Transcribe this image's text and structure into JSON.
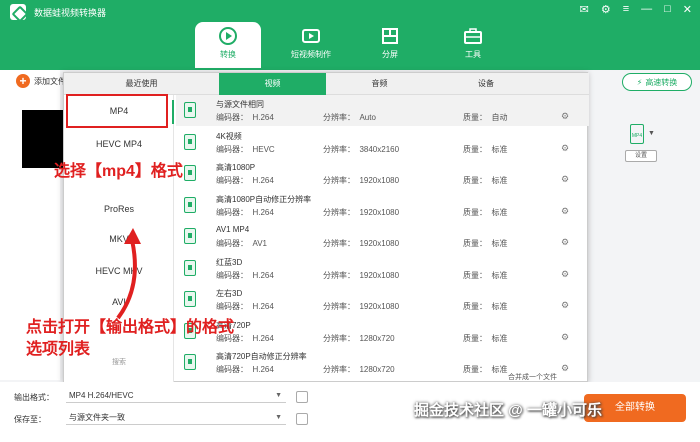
{
  "app": {
    "title": "数据蛙视频转换器",
    "win_controls": [
      "✉",
      "⚙",
      "≡",
      "—",
      "□",
      "✕"
    ]
  },
  "nav": [
    {
      "label": "转换",
      "icon": "convert-icon",
      "active": true
    },
    {
      "label": "短视频制作",
      "icon": "video-icon",
      "active": false
    },
    {
      "label": "分屏",
      "icon": "split-icon",
      "active": false
    },
    {
      "label": "工具",
      "icon": "toolbox-icon",
      "active": false
    }
  ],
  "left": {
    "add_label": "添加文件"
  },
  "right": {
    "speed_label": "高速转换",
    "settings_label": "设置",
    "format_badge": "MP4"
  },
  "popup": {
    "tabs": [
      "最近使用",
      "视频",
      "音频",
      "设备"
    ],
    "active_tab": 1,
    "categories": [
      "MP4",
      "HEVC MP4",
      "MOV",
      "ProRes",
      "MKV",
      "HEVC MKV",
      "AVI",
      "WebM",
      "5K/8K 视频"
    ],
    "selected_category": "MP4",
    "enc_label": "编码器：",
    "res_label": "分辨率：",
    "qual_label": "质量：",
    "formats": [
      {
        "name": "与源文件相同",
        "enc": "H.264",
        "res": "Auto",
        "qual": "自动"
      },
      {
        "name": "4K视频",
        "enc": "HEVC",
        "res": "3840x2160",
        "qual": "标准"
      },
      {
        "name": "高清1080P",
        "enc": "H.264",
        "res": "1920x1080",
        "qual": "标准"
      },
      {
        "name": "高清1080P自动修正分辨率",
        "enc": "H.264",
        "res": "1920x1080",
        "qual": "标准"
      },
      {
        "name": "AV1 MP4",
        "enc": "AV1",
        "res": "1920x1080",
        "qual": "标准"
      },
      {
        "name": "红蓝3D",
        "enc": "H.264",
        "res": "1920x1080",
        "qual": "标准"
      },
      {
        "name": "左右3D",
        "enc": "H.264",
        "res": "1920x1080",
        "qual": "标准"
      },
      {
        "name": "高清720P",
        "enc": "H.264",
        "res": "1280x720",
        "qual": "标准"
      },
      {
        "name": "高清720P自动修正分辨率",
        "enc": "H.264",
        "res": "1280x720",
        "qual": "标准"
      }
    ],
    "search_label": "搜索"
  },
  "bottom": {
    "output_label": "输出格式：",
    "output_value": "MP4 H.264/HEVC",
    "save_label": "保存至：",
    "save_value": "与源文件夹一致",
    "merge_label": "合并成一个文件",
    "convert_label": "全部转换"
  },
  "annotations": {
    "select_mp4": "选择【mp4】格式",
    "click_open_line1": "点击打开【输出格式】的格式",
    "click_open_line2": "选项列表"
  },
  "watermark": "掘金技术社区 @ 一罐小可乐",
  "colors": {
    "brand": "#1fad66",
    "accent": "#f06a20",
    "annotation": "#e02020"
  }
}
